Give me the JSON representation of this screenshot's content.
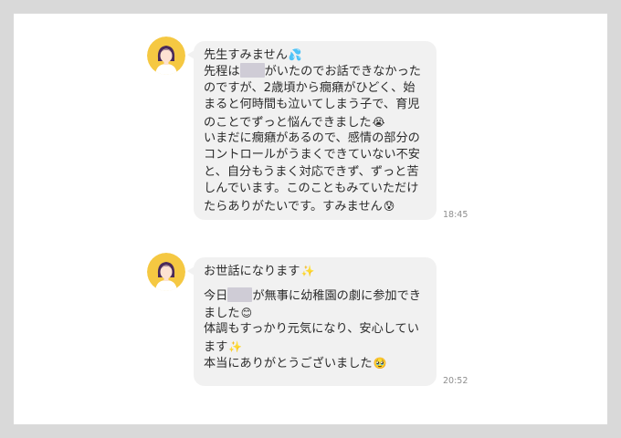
{
  "messages": [
    {
      "time": "18:45",
      "lines": [
        {
          "a": "先生すみません",
          "emoji": "💦"
        },
        {
          "a": "先程は",
          "redacted": true,
          "b": "がいたのでお話できなかった"
        },
        {
          "a": "のですが、2歳頃から癇癪がひどく、始"
        },
        {
          "a": "まると何時間も泣いてしまう子で、育児"
        },
        {
          "a": "のことでずっと悩んできました",
          "emoji": "😭"
        },
        {
          "a": "いまだに癇癪があるので、感情の部分の"
        },
        {
          "a": "コントロールがうまくできていない不安"
        },
        {
          "a": "と、自分もうまく対応できず、ずっと苦"
        },
        {
          "a": "しんでいます。このこともみていただけ"
        },
        {
          "a": "たらありがたいです。すみません",
          "emoji": "😰"
        }
      ]
    },
    {
      "time": "20:52",
      "lines": [
        {
          "a": "お世話になります",
          "emoji": "✨"
        },
        {
          "a": "今日",
          "redacted": true,
          "b": "が無事に幼稚園の劇に参加でき"
        },
        {
          "a": "ました",
          "emoji": "😊"
        },
        {
          "a": "体調もすっかり元気になり、安心してい"
        },
        {
          "a": "ます",
          "emoji": "✨"
        },
        {
          "a": "本当にありがとうございました",
          "emoji": "🥹"
        }
      ]
    }
  ],
  "colors": {
    "background": "#d9d9d9",
    "panel": "#ffffff",
    "bubble": "#f1f1f1",
    "avatar_bg": "#f5c842",
    "hair": "#4a2a5a",
    "redaction": "#cfccd6"
  }
}
